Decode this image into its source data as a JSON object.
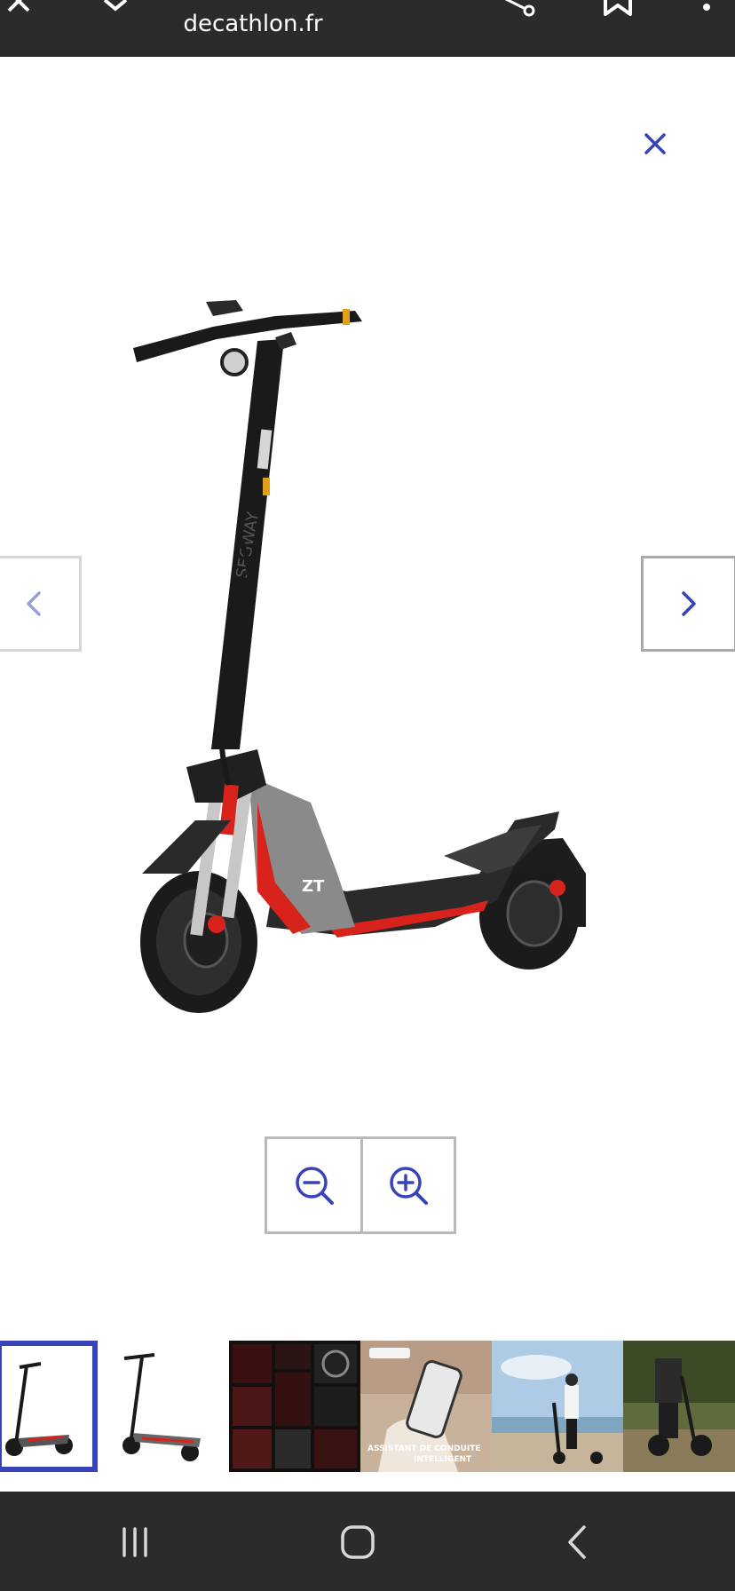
{
  "browser": {
    "url": "decathlon.fr",
    "icons": [
      "close-icon",
      "download-icon",
      "share-icon",
      "bookmark-icon",
      "more-icon"
    ]
  },
  "viewer": {
    "close_icon": "close-icon",
    "prev_icon": "chevron-left-icon",
    "next_icon": "chevron-right-icon",
    "zoom_out_icon": "zoom-out-icon",
    "zoom_in_icon": "zoom-in-icon",
    "product_brand_text": "SEGWAY",
    "product_model_text": "ZT"
  },
  "thumbnails": {
    "selected_index": 0,
    "items": [
      {
        "kind": "scooter-side"
      },
      {
        "kind": "scooter-rear"
      },
      {
        "kind": "features-collage"
      },
      {
        "kind": "app-hand",
        "caption": "ASSISTANT DE CONDUITE INTELLIGENT"
      },
      {
        "kind": "rider-beach"
      },
      {
        "kind": "rider-trail"
      }
    ]
  },
  "colors": {
    "accent": "#3643ba",
    "bar_dark": "#2b2b2e",
    "scooter_red": "#d8231c"
  },
  "system_nav": {
    "icons": [
      "recent-apps-icon",
      "home-icon",
      "back-icon"
    ]
  }
}
